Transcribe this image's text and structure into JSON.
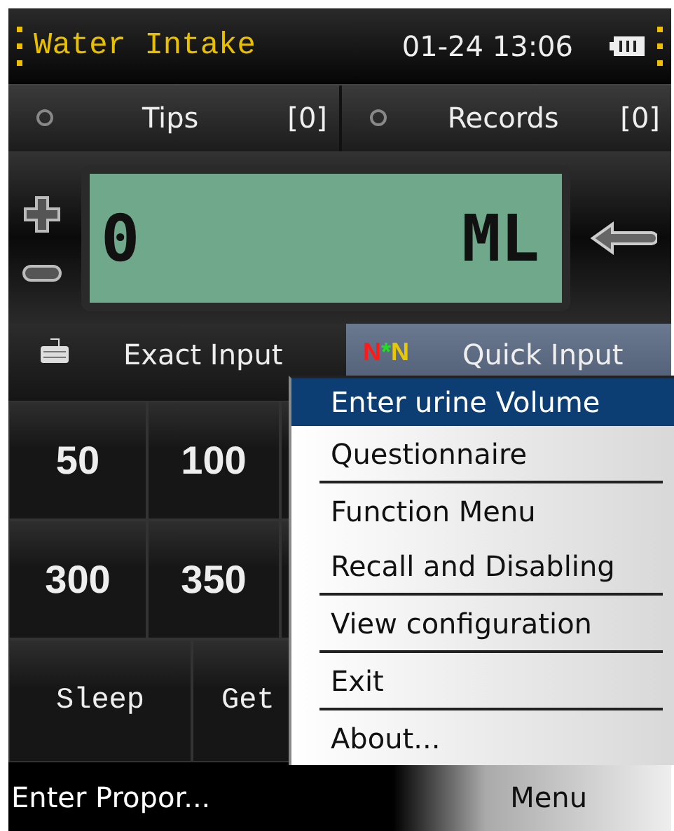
{
  "status_bar": {
    "title": "Water Intake",
    "time": "01-24 13:06"
  },
  "tabs": [
    {
      "label": "Tips",
      "count": "[0]",
      "selected": false
    },
    {
      "label": "Records",
      "count": "[0]",
      "selected": false
    }
  ],
  "display": {
    "value": "0",
    "unit": "ML"
  },
  "input_tabs": [
    {
      "kind": "keyboard",
      "label": "Exact Input",
      "selected": false
    },
    {
      "kind": "quick",
      "icon_text": "N*N",
      "label": "Quick Input",
      "selected": true
    }
  ],
  "grid": [
    [
      "50",
      "100"
    ],
    [
      "300",
      "350"
    ]
  ],
  "actions": [
    "Sleep",
    "Get"
  ],
  "menu": [
    {
      "label": "Enter urine Volume",
      "selected": true,
      "separator_after": false
    },
    {
      "label": "Questionnaire",
      "selected": false,
      "separator_after": true
    },
    {
      "label": "Function Menu",
      "selected": false,
      "separator_after": false
    },
    {
      "label": "Recall and Disabling",
      "selected": false,
      "separator_after": true
    },
    {
      "label": "View configuration",
      "selected": false,
      "separator_after": true
    },
    {
      "label": "Exit",
      "selected": false,
      "separator_after": true
    },
    {
      "label": "About...",
      "selected": false,
      "separator_after": false
    }
  ],
  "soft_keys": {
    "left": "Enter Propor...",
    "right": "Menu"
  }
}
